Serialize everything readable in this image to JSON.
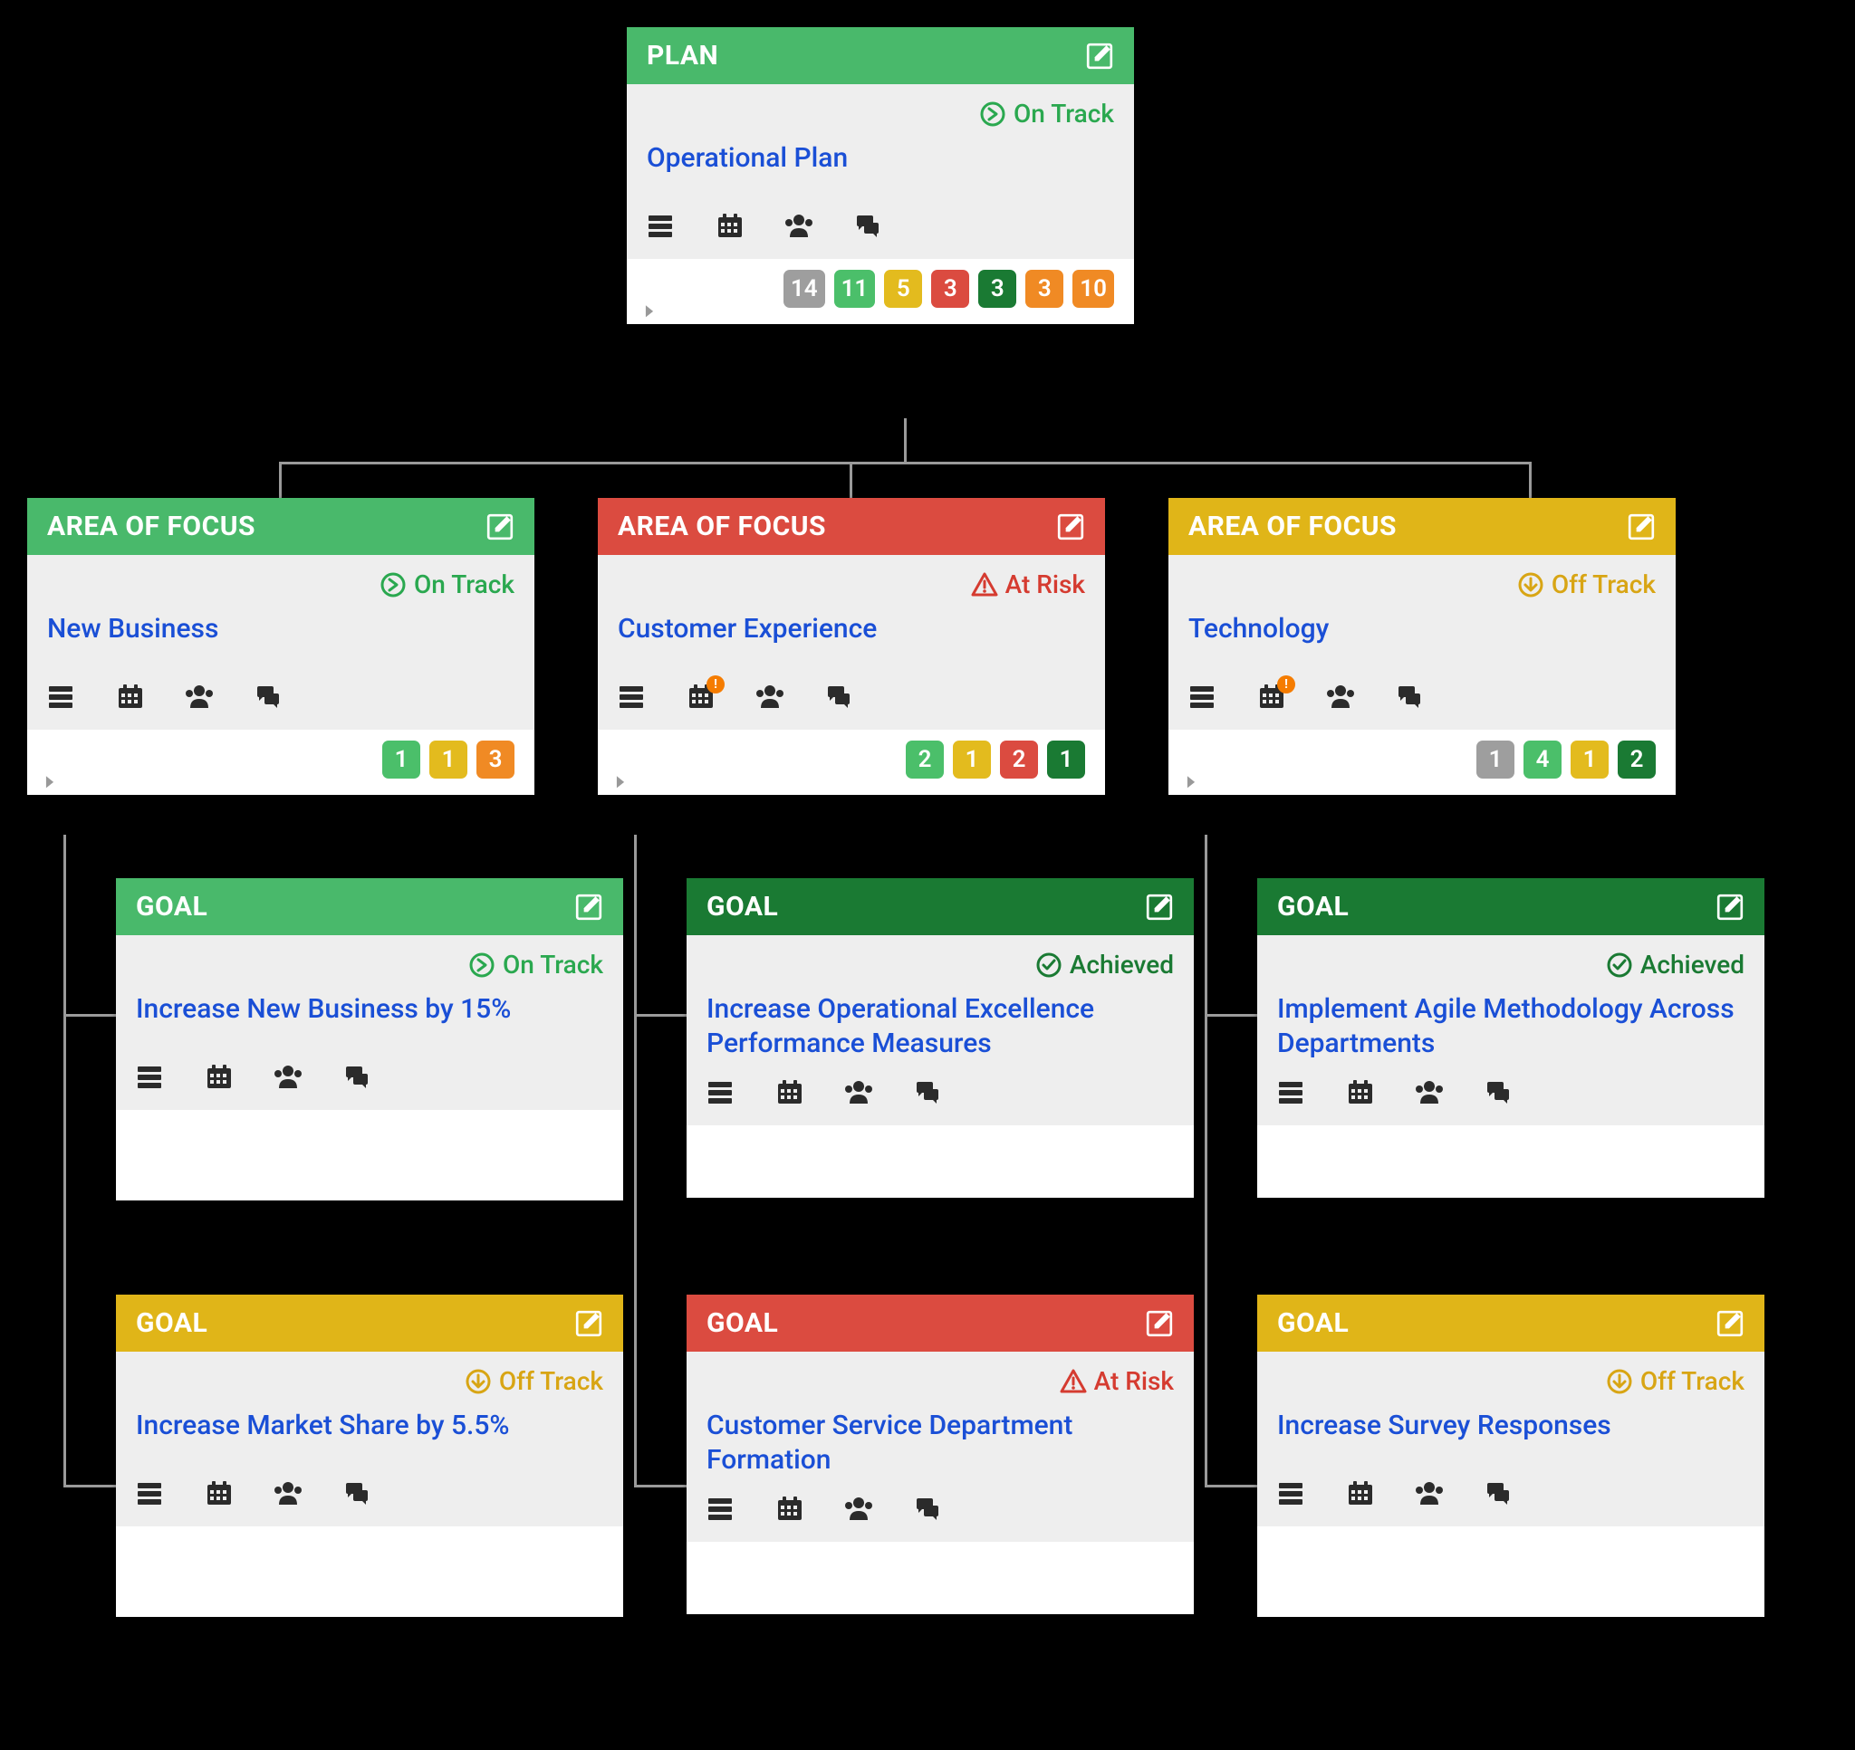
{
  "colors": {
    "header_green_light": "#49b96b",
    "header_green_dark": "#1a7a33",
    "header_yellow": "#e0b518",
    "header_red": "#db4b40",
    "badge_grey": "#9e9e9e",
    "badge_green_light": "#4bbf6a",
    "badge_yellow": "#e3bb1e",
    "badge_red": "#db4b40",
    "badge_green_dark": "#1a7a33",
    "badge_orange": "#f08a24",
    "link": "#1a4fd6"
  },
  "status_labels": {
    "on_track": "On Track",
    "off_track": "Off Track",
    "at_risk": "At Risk",
    "achieved": "Achieved"
  },
  "icon_names": {
    "server": "server-icon",
    "calendar": "calendar-icon",
    "people": "people-icon",
    "comments": "comments-icon",
    "edit": "edit-icon"
  },
  "plan": {
    "header": "PLAN",
    "status": "on_track",
    "title": "Operational Plan",
    "icons_alert_on": null,
    "badges": [
      {
        "color": "grey",
        "value": 14
      },
      {
        "color": "greenL",
        "value": 11
      },
      {
        "color": "yellow",
        "value": 5
      },
      {
        "color": "red",
        "value": 3
      },
      {
        "color": "greenD",
        "value": 3
      },
      {
        "color": "orange",
        "value": 3
      },
      {
        "color": "orange",
        "value": 10
      }
    ]
  },
  "areas": [
    {
      "header": "AREA OF FOCUS",
      "status": "on_track",
      "header_color": "green_light",
      "title": "New Business",
      "icons_alert_on": null,
      "badges": [
        {
          "color": "greenL",
          "value": 1
        },
        {
          "color": "yellow",
          "value": 1
        },
        {
          "color": "orange",
          "value": 3
        }
      ],
      "goals": [
        {
          "header": "GOAL",
          "header_color": "green_light",
          "status": "on_track",
          "title": "Increase New Business by 15%"
        },
        {
          "header": "GOAL",
          "header_color": "yellow",
          "status": "off_track",
          "title": "Increase Market Share by 5.5%"
        }
      ]
    },
    {
      "header": "AREA OF FOCUS",
      "status": "at_risk",
      "header_color": "red",
      "title": "Customer Experience",
      "icons_alert_on": "calendar",
      "badges": [
        {
          "color": "greenL",
          "value": 2
        },
        {
          "color": "yellow",
          "value": 1
        },
        {
          "color": "red",
          "value": 2
        },
        {
          "color": "greenD",
          "value": 1
        }
      ],
      "goals": [
        {
          "header": "GOAL",
          "header_color": "green_dark",
          "status": "achieved",
          "title": "Increase Operational Excellence Performance Measures"
        },
        {
          "header": "GOAL",
          "header_color": "red",
          "status": "at_risk",
          "title": "Customer Service Department Formation"
        }
      ]
    },
    {
      "header": "AREA OF FOCUS",
      "status": "off_track",
      "header_color": "yellow",
      "title": "Technology",
      "icons_alert_on": "calendar",
      "badges": [
        {
          "color": "grey",
          "value": 1
        },
        {
          "color": "greenL",
          "value": 4
        },
        {
          "color": "yellow",
          "value": 1
        },
        {
          "color": "greenD",
          "value": 2
        }
      ],
      "goals": [
        {
          "header": "GOAL",
          "header_color": "green_dark",
          "status": "achieved",
          "title": "Implement Agile Methodology Across Departments"
        },
        {
          "header": "GOAL",
          "header_color": "yellow",
          "status": "off_track",
          "title": "Increase Survey Responses"
        }
      ]
    }
  ]
}
